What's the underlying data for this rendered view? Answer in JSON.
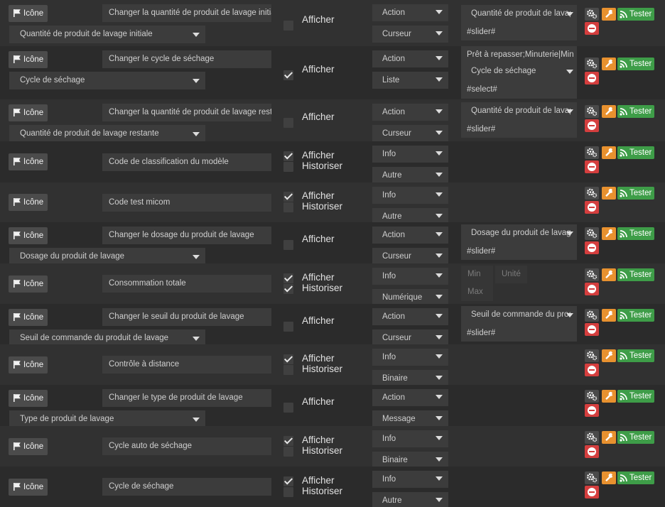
{
  "icon_button_label": "Icône",
  "tester_label": "Tester",
  "labels": {
    "afficher": "Afficher",
    "historiser": "Historiser"
  },
  "colors": {
    "background": "#2b2b2b",
    "row_alt": "#313131",
    "field": "#3c3c3c",
    "wrench": "#e8912f",
    "tester": "#3e9d48",
    "remove": "#d43e3e"
  },
  "commands": [
    {
      "name": "Changer la quantité de produit de lavage initia",
      "value_select": "Quantité de produit de lavage initiale",
      "afficher": false,
      "historiser": null,
      "type": "Action",
      "subtype": "Curseur",
      "config": {
        "kind": "slider",
        "select": "Quantité de produit de lavage",
        "template": "#slider#"
      }
    },
    {
      "name": "Changer le cycle de séchage",
      "value_select": "Cycle de séchage",
      "afficher": true,
      "historiser": null,
      "type": "Action",
      "subtype": "Liste",
      "config": {
        "kind": "list",
        "list_values": "Prêt à repasser;Minuterie|Minu",
        "select": "Cycle de séchage",
        "template": "#select#"
      }
    },
    {
      "name": "Changer la quantité de produit de lavage resta",
      "value_select": "Quantité de produit de lavage restante",
      "afficher": false,
      "historiser": null,
      "type": "Action",
      "subtype": "Curseur",
      "config": {
        "kind": "slider",
        "select": "Quantité de produit de lavage",
        "template": "#slider#"
      }
    },
    {
      "name": "Code de classification du modèle",
      "value_select": null,
      "afficher": true,
      "historiser": false,
      "type": "Info",
      "subtype": "Autre",
      "config": null
    },
    {
      "name": "Code test micom",
      "value_select": null,
      "afficher": true,
      "historiser": false,
      "type": "Info",
      "subtype": "Autre",
      "config": null
    },
    {
      "name": "Changer le dosage du produit de lavage",
      "value_select": "Dosage du produit de lavage",
      "afficher": false,
      "historiser": null,
      "type": "Action",
      "subtype": "Curseur",
      "config": {
        "kind": "slider",
        "select": "Dosage du produit de lavage",
        "template": "#slider#"
      }
    },
    {
      "name": "Consommation totale",
      "value_select": null,
      "afficher": true,
      "historiser": true,
      "type": "Info",
      "subtype": "Numérique",
      "config": {
        "kind": "numeric",
        "min_placeholder": "Min",
        "unit_placeholder": "Unité",
        "max_placeholder": "Max"
      }
    },
    {
      "name": "Changer le seuil du produit de lavage",
      "value_select": "Seuil de commande du produit de lavage",
      "afficher": false,
      "historiser": null,
      "type": "Action",
      "subtype": "Curseur",
      "config": {
        "kind": "slider",
        "select": "Seuil de commande du produ",
        "template": "#slider#"
      }
    },
    {
      "name": "Contrôle à distance",
      "value_select": null,
      "afficher": true,
      "historiser": false,
      "type": "Info",
      "subtype": "Binaire",
      "config": null
    },
    {
      "name": "Changer le type de produit de lavage",
      "value_select": "Type de produit de lavage",
      "afficher": false,
      "historiser": null,
      "type": "Action",
      "subtype": "Message",
      "config": null
    },
    {
      "name": "Cycle auto de séchage",
      "value_select": null,
      "afficher": true,
      "historiser": false,
      "type": "Info",
      "subtype": "Binaire",
      "config": null
    },
    {
      "name": "Cycle de séchage",
      "value_select": null,
      "afficher": true,
      "historiser": false,
      "type": "Info",
      "subtype": "Autre",
      "config": null
    }
  ]
}
